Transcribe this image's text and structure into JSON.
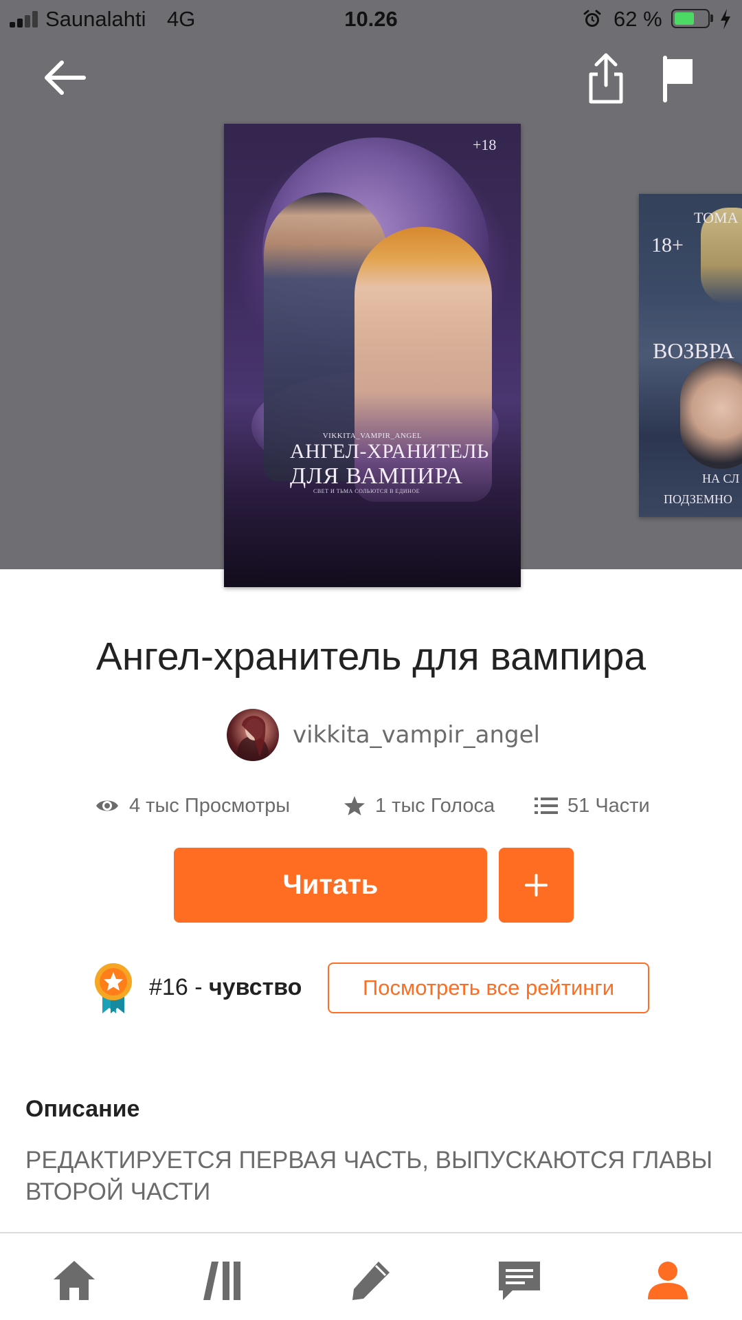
{
  "status_bar": {
    "carrier": "Saunalahti",
    "network": "4G",
    "time": "10.26",
    "battery_percent": "62 %",
    "battery_level": 0.62
  },
  "header": {
    "icons": [
      "back-arrow-icon",
      "share-icon",
      "flag-icon"
    ]
  },
  "cover_main": {
    "age_badge": "+18",
    "author": "VIKKITA_VAMPIR_ANGEL",
    "title_line1": "Ангел-хранитель",
    "title_line2": "для вампира",
    "tagline": "СВЕТ И ТЬМА СОЛЬЮТСЯ В ЕДИНОЕ"
  },
  "cover_next": {
    "top_text": "ТОМА",
    "age_badge": "18+",
    "title_fragment": "ВОЗВРА",
    "bottom_line1": "НА СЛ",
    "bottom_line2": "ПОДЗЕМНО"
  },
  "book": {
    "title": "Ангел-хранитель для вампира",
    "author": "vikkita_vampir_angel",
    "stats": {
      "views": "4 тыс Просмотры",
      "votes": "1 тыс Голоса",
      "parts": "51 Части"
    },
    "read_label": "Читать",
    "add_label": "+",
    "rank": {
      "number": "#16",
      "separator": "-",
      "tag": "чувство"
    },
    "all_ratings_label": "Посмотреть все рейтинги",
    "description_label": "Описание",
    "description": "РЕДАКТИРУЕТСЯ ПЕРВАЯ ЧАСТЬ, ВЫПУСКАЮТСЯ ГЛАВЫ ВТОРОЙ ЧАСТИ"
  },
  "bottom_nav": {
    "items": [
      "home-icon",
      "library-icon",
      "write-icon",
      "messages-icon",
      "profile-icon"
    ],
    "active": "profile-icon",
    "accent": "#ff6d22"
  },
  "colors": {
    "accent": "#ff6d22",
    "header_bg": "#6f6e72",
    "muted_text": "#6b6b6b"
  }
}
